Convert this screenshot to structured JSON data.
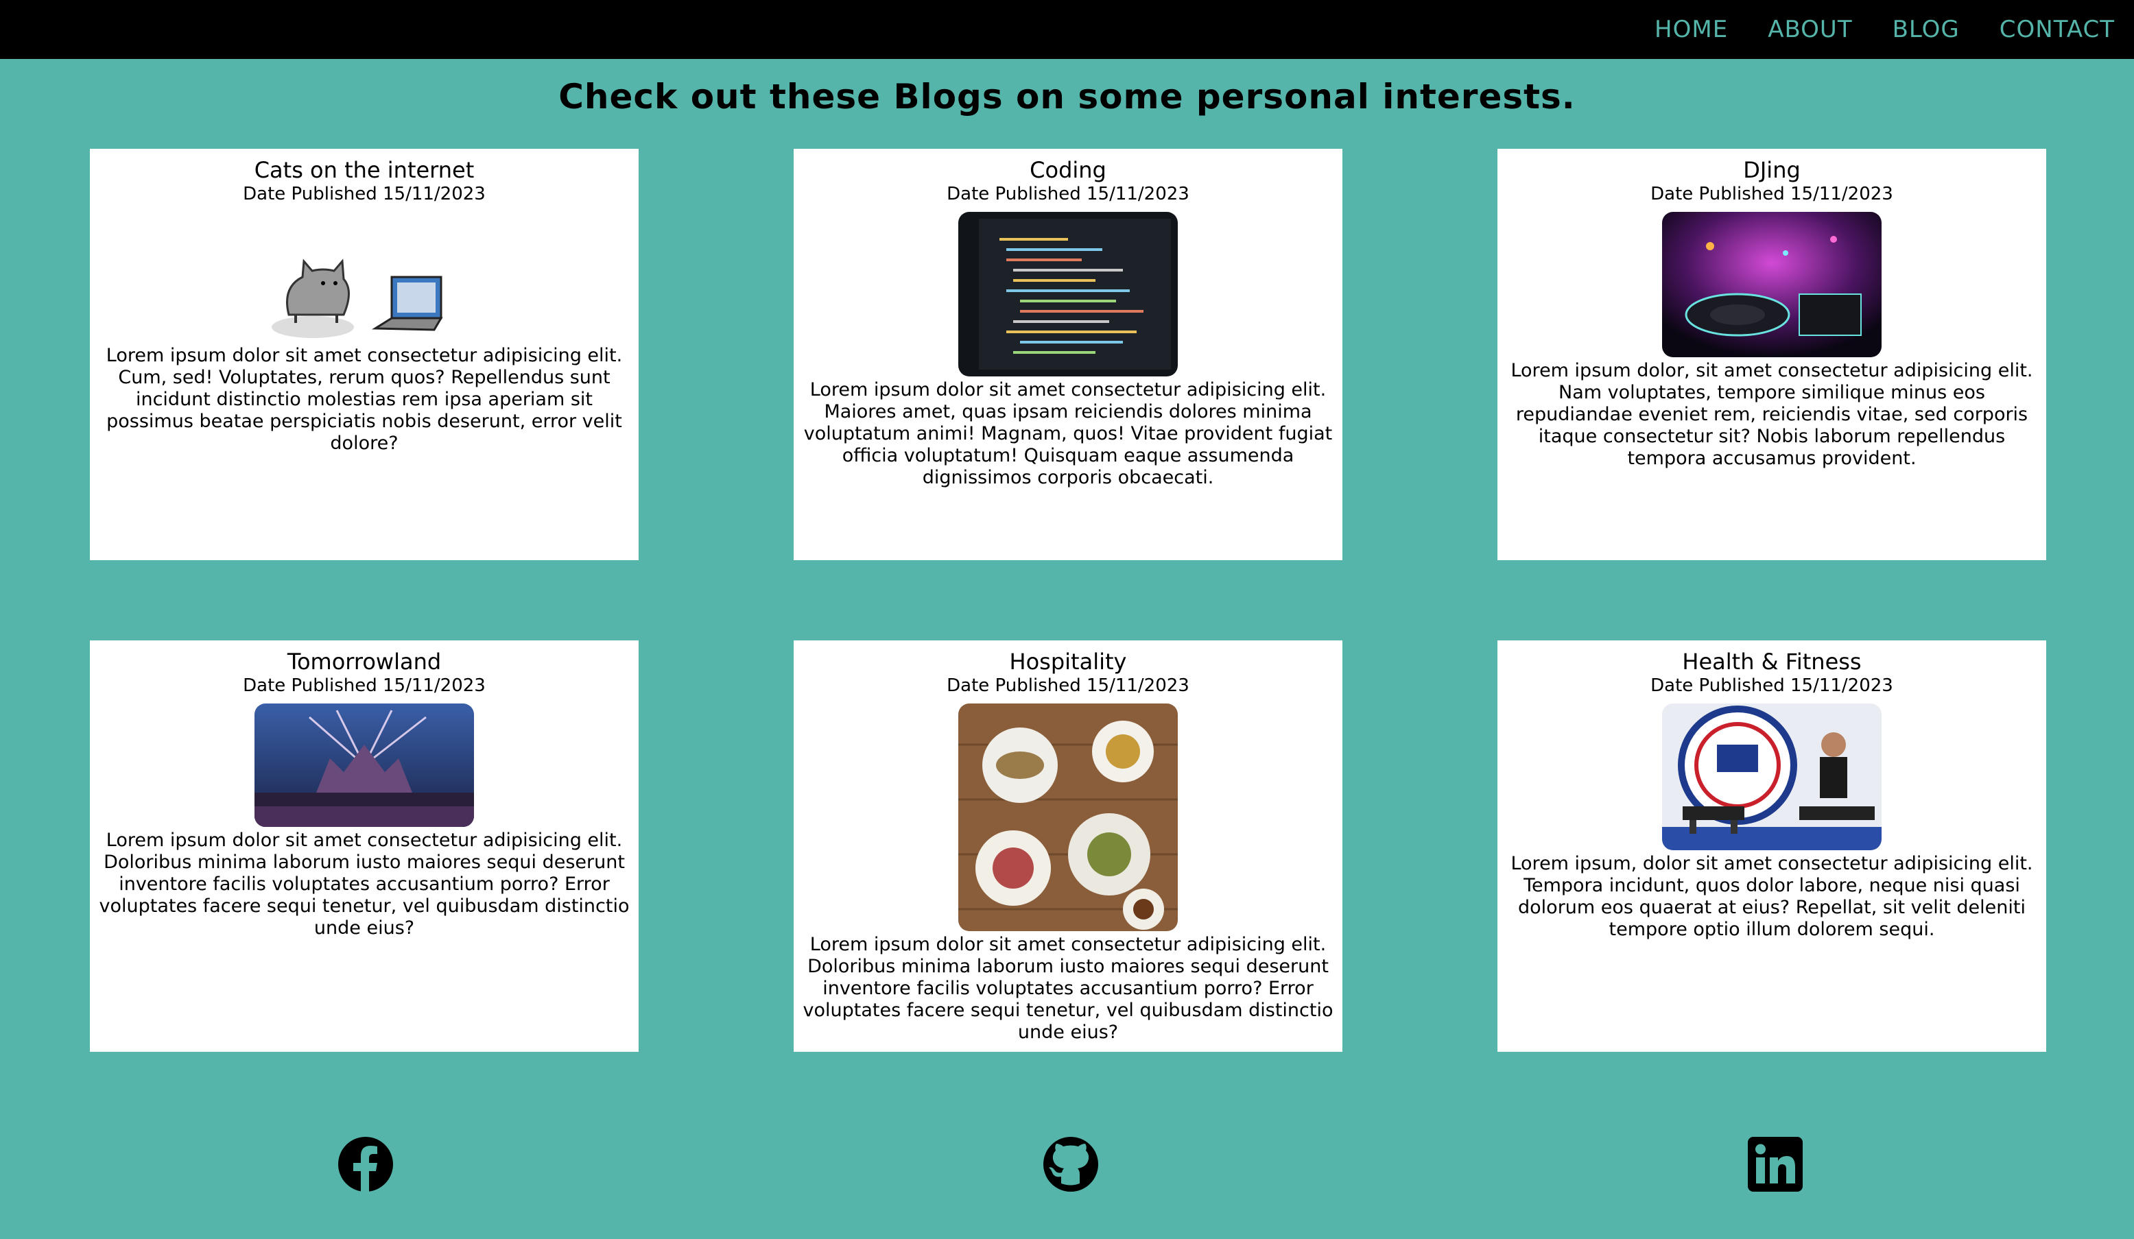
{
  "nav": {
    "items": [
      "Home",
      "About",
      "Blog",
      "Contact"
    ]
  },
  "page": {
    "title": "Check out these Blogs on some personal interests."
  },
  "cards": [
    {
      "title": "Cats on the internet",
      "date": "Date Published 15/11/2023",
      "image": "cat-and-laptop-illustration",
      "body": "Lorem ipsum dolor sit amet consectetur adipisicing elit. Cum, sed! Voluptates, rerum quos? Repellendus sunt incidunt distinctio molestias rem ipsa aperiam sit possimus beatae perspiciatis nobis deserunt, error velit dolore?"
    },
    {
      "title": "Coding",
      "date": "Date Published 15/11/2023",
      "image": "code-on-monitor-photo",
      "body": "Lorem ipsum dolor sit amet consectetur adipisicing elit. Maiores amet, quas ipsam reiciendis dolores minima voluptatum animi! Magnam, quos! Vitae provident fugiat officia voluptatum! Quisquam eaque assumenda dignissimos corporis obcaecati."
    },
    {
      "title": "DJing",
      "date": "Date Published 15/11/2023",
      "image": "dj-deck-photo",
      "body": "Lorem ipsum dolor, sit amet consectetur adipisicing elit. Nam voluptates, tempore similique minus eos repudiandae eveniet rem, reiciendis vitae, sed corporis itaque consectetur sit? Nobis laborum repellendus tempora accusamus provident."
    },
    {
      "title": "Tomorrowland",
      "date": "Date Published 15/11/2023",
      "image": "festival-stage-photo",
      "body": "Lorem ipsum dolor sit amet consectetur adipisicing elit. Doloribus minima laborum iusto maiores sequi deserunt inventore facilis voluptates accusantium porro? Error voluptates facere sequi tenetur, vel quibusdam distinctio unde eius?"
    },
    {
      "title": "Hospitality",
      "date": "Date Published 15/11/2023",
      "image": "food-plates-photo",
      "body": "Lorem ipsum dolor sit amet consectetur adipisicing elit. Doloribus minima laborum iusto maiores sequi deserunt inventore facilis voluptates accusantium porro? Error voluptates facere sequi tenetur, vel quibusdam distinctio unde eius?"
    },
    {
      "title": "Health & Fitness",
      "date": "Date Published 15/11/2023",
      "image": "f45-gym-photo",
      "body": "Lorem ipsum, dolor sit amet consectetur adipisicing elit. Tempora incidunt, quos dolor labore, neque nisi quasi dolorum eos quaerat at eius? Repellat, sit velit deleniti tempore optio illum dolorem sequi."
    }
  ],
  "footer": {
    "icons": [
      "facebook-icon",
      "github-icon",
      "linkedin-icon"
    ]
  },
  "colors": {
    "background": "#55b5aa",
    "nav_background": "#000000",
    "nav_text": "#55b5aa",
    "card_background": "#ffffff"
  }
}
